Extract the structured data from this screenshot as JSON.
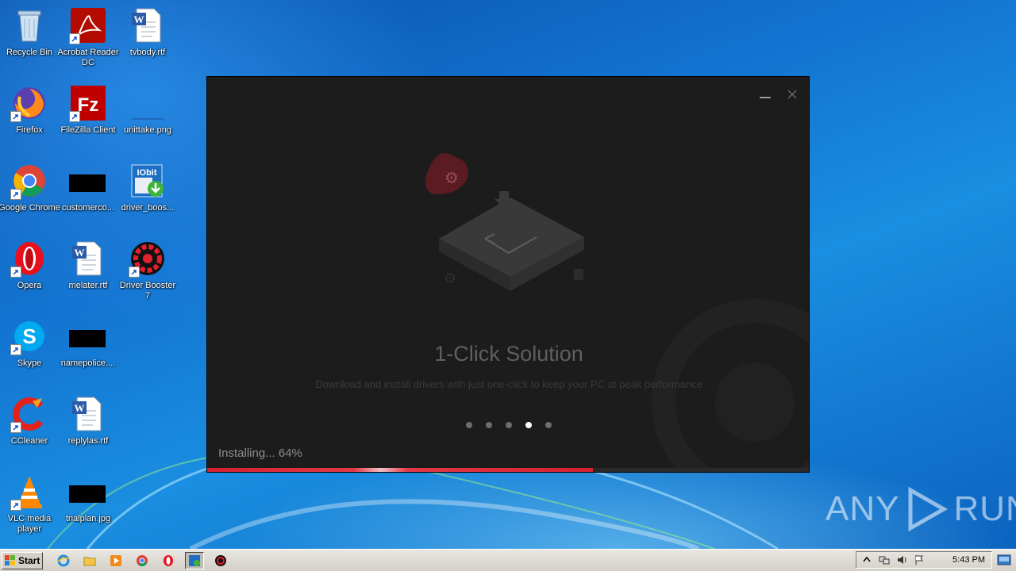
{
  "desktop": {
    "icons": [
      {
        "label": "Recycle Bin",
        "icon": "recycle-bin-icon"
      },
      {
        "label": "Acrobat Reader DC",
        "icon": "acrobat-icon"
      },
      {
        "label": "tvbody.rtf",
        "icon": "word-doc-icon"
      },
      {
        "label": "Firefox",
        "icon": "firefox-icon"
      },
      {
        "label": "FileZilla Client",
        "icon": "filezilla-icon"
      },
      {
        "label": "unittake.png",
        "icon": "image-file-icon"
      },
      {
        "label": "Google Chrome",
        "icon": "chrome-icon"
      },
      {
        "label": "customerco...",
        "icon": "black-file-icon"
      },
      {
        "label": "driver_boos...",
        "icon": "iobit-installer-icon"
      },
      {
        "label": "Opera",
        "icon": "opera-icon"
      },
      {
        "label": "melater.rtf",
        "icon": "word-doc-icon"
      },
      {
        "label": "Driver Booster 7",
        "icon": "driver-booster-icon"
      },
      {
        "label": "Skype",
        "icon": "skype-icon"
      },
      {
        "label": "namepolice....",
        "icon": "black-file-icon"
      },
      {
        "label": "CCleaner",
        "icon": "ccleaner-icon"
      },
      {
        "label": "replylas.rtf",
        "icon": "word-doc-icon"
      },
      {
        "label": "VLC media player",
        "icon": "vlc-icon"
      },
      {
        "label": "trialplan.jpg",
        "icon": "black-file-icon"
      }
    ]
  },
  "installer": {
    "slide_title": "1-Click Solution",
    "slide_description": "Download and install drivers with just one-click to keep your PC at peak performance",
    "dots_total": 5,
    "active_dot": 4,
    "status_text": "Installing... 64%",
    "progress": 0.64,
    "accent_color": "#e0283a"
  },
  "watermark": {
    "left_text": "ANY",
    "right_text": "RUN"
  },
  "taskbar": {
    "start_label": "Start",
    "clock": "5:43 PM"
  }
}
